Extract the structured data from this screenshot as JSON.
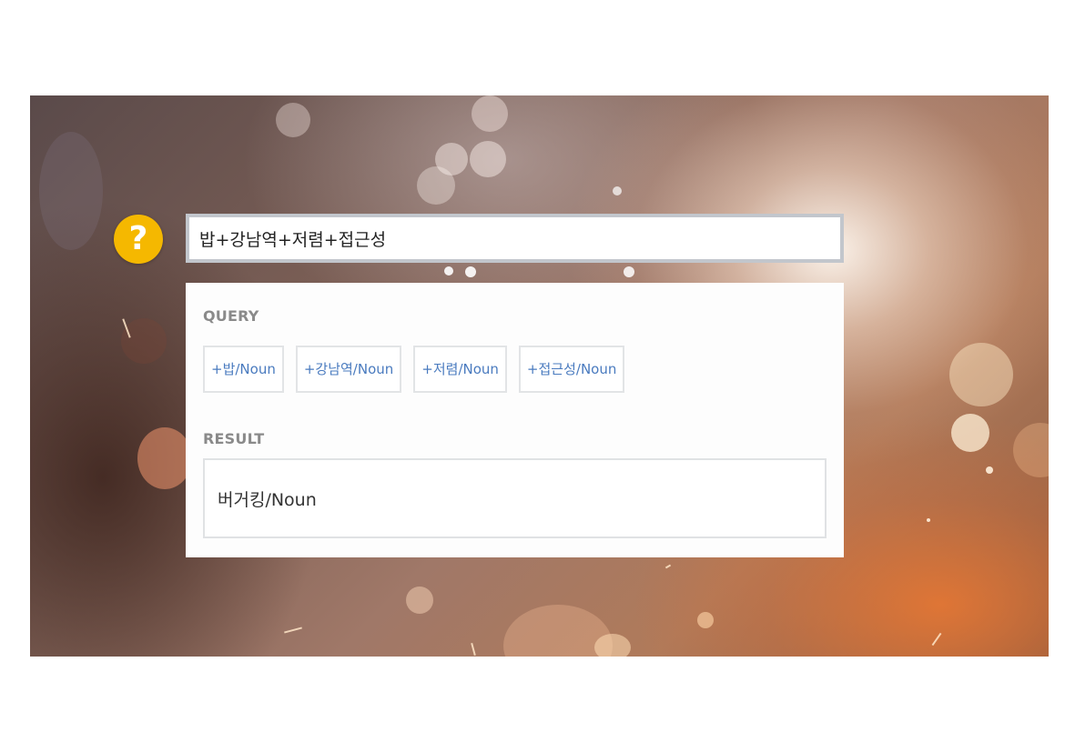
{
  "help": {
    "icon": "question-mark-icon",
    "glyph": "?",
    "color": "#f5b800"
  },
  "search": {
    "value": "밥+강남역+저렴+접근성"
  },
  "query": {
    "label": "QUERY",
    "chips": [
      "+밥/Noun",
      "+강남역/Noun",
      "+저렴/Noun",
      "+접근성/Noun"
    ],
    "chip_text_color": "#4a7bbf"
  },
  "result": {
    "label": "RESULT",
    "value": "버거킹/Noun"
  }
}
